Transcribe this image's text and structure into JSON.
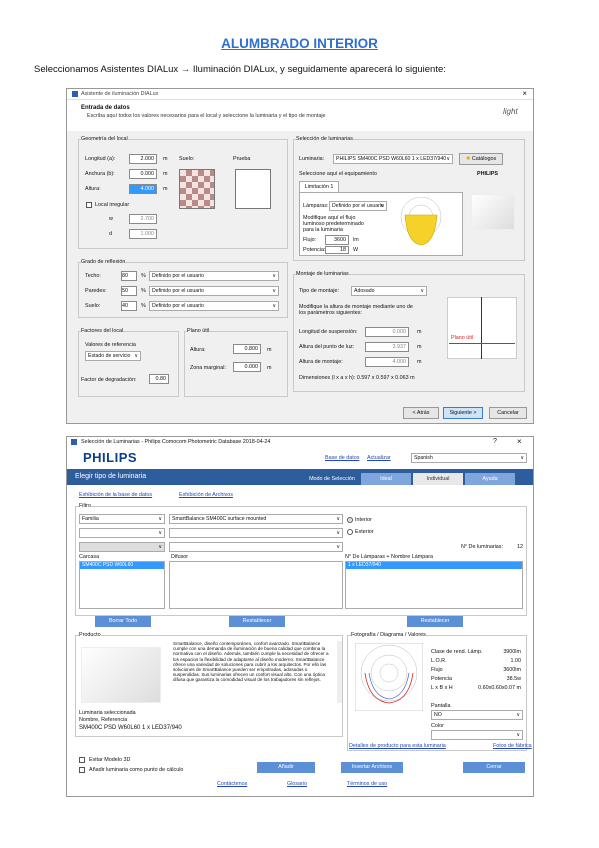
{
  "heading": "ALUMBRADO INTERIOR",
  "intro": "Seleccionamos Asistentes DIALux → Iluminación DIALux, y seguidamente aparecerá lo siguiente:",
  "d1": {
    "title": "Asistente de iluminación DIALux",
    "close": "×",
    "entry_title": "Entrada de datos",
    "entry_sub": "Escriba aquí todos los valores necesarios para el local y seleccione la luminaria y el tipo de montaje",
    "logo": "light",
    "geometry": {
      "legend": "Geometría del local",
      "length_label": "Longitud (a):",
      "length": "2.000",
      "width_label": "Anchura (b):",
      "width": "0.000",
      "height_label": "Altura:",
      "height": "4.000",
      "unit": "m",
      "irregular": "Local irregular",
      "w_label": "w",
      "w_val": "2.700",
      "d_label": "d",
      "d_val": "1.000",
      "suelo": "Suelo:",
      "prueba": "Prueba"
    },
    "reflect": {
      "legend": "Grado de reflexión",
      "rows": [
        {
          "label": "Techo:",
          "val": "80",
          "opt": "Definido por el usuario"
        },
        {
          "label": "Paredes:",
          "val": "50",
          "opt": "Definido por el usuario"
        },
        {
          "label": "Suelo:",
          "val": "40",
          "opt": "Definido por el usuario"
        }
      ],
      "pct": "%"
    },
    "factors": {
      "legend": "Factores del local",
      "ref_label": "Valores de referencia",
      "ref_val": "Estado de servicio",
      "maint_label": "Factor de degradación:",
      "maint_val": "0.80"
    },
    "plane": {
      "legend": "Plano útil",
      "height_label": "Altura:",
      "height": "0.800",
      "zone_label": "Zona marginal:",
      "zone": "0.000",
      "unit": "m"
    },
    "lum": {
      "legend": "Selección de luminarias",
      "label": "Luminaria:",
      "value": "PHILIPS SM400C PSD W60L60 1 x LED37/940",
      "catalog": "Catálogos",
      "pick": "Seleccione aquí el equipamiento",
      "brand": "PHILIPS",
      "tab": "Limitación 1",
      "lamp_label": "Lámparas:",
      "lamp_val": "Definido por el usuario",
      "modify": "Modifique aquí el flujo luminoso predeterminado para la luminaria",
      "flux_label": "Flujo:",
      "flux": "3600",
      "flux_unit": "lm",
      "power_label": "Potencia:",
      "power": "18",
      "power_unit": "W"
    },
    "mount": {
      "legend": "Montaje de luminarias",
      "type_label": "Tipo de montaje:",
      "type_val": "Adosado",
      "note": "Modifique la altura de montaje mediante uno de los parámetros siguientes:",
      "susp_label": "Longitud de suspensión:",
      "susp": "0.000",
      "plane_label": "Altura del punto de luz:",
      "plane": "3.937",
      "mnt_label": "Altura de montaje:",
      "mnt": "4.000",
      "unit": "m",
      "dims": "Dimensiones (l x a x h): 0.597 x 0.597 x 0.063 m",
      "ref_plane": "Plano útil"
    },
    "buttons": {
      "back": "< Atrás",
      "next": "Siguiente >",
      "cancel": "Cancelar"
    }
  },
  "d2": {
    "title": "Selección de Luminarias - Philips Comocom Photometric Database 2018-04-24",
    "help": "?",
    "close": "×",
    "logo": "PHILIPS",
    "top_links": {
      "base": "Base de datos",
      "update": "Actualizar",
      "lang": "Spanish"
    },
    "banner": "Elegir tipo de luminaria",
    "tabs": [
      "Modo de Selección",
      "Ideal",
      "Individual",
      "Ayuda"
    ],
    "sub_links": [
      "Exhibición de la base de datos",
      "Exhibición de Archivos"
    ],
    "filter_legend": "Filtro",
    "filter_sel1": "Familia",
    "filter_sel2": "SmartBalance SM400C surface mounted",
    "radio1": "Interior",
    "radio2": "Exterior",
    "count_label": "N° De luminarias:",
    "count": "12",
    "col1_head": "Carcasa",
    "col1_item": "SM400C PSD W60L60",
    "col2_head": "Difusor",
    "col3_head": "N° De Lámparas + Nombre Lámpara",
    "col3_item": "1 x LED37/940",
    "btn_remove": "Borrar Todo",
    "btn_reset": "Restablecer",
    "btn_reset2": "Restablecer",
    "product_legend": "Producto",
    "product_text": "SmartBalance, diseño contemporáneo, confort avanzado. SmartBalance cumple con una demanda de iluminación de buena calidad que combina la normativa con el diseño. Además, también cumple la necesidad de ofrecer a los espacios la flexibilidad de adaptarse al diseño moderno. SmartBalance ofrece una variedad de soluciones para cubrir a los arquitectos. Por ello las soluciones de SmartBalance pueden ser empotradas, adosadas o suspendidas. Sus luminarias ofrecen un confort visual alto. Con una óptica difusa que garantiza la comodidad visual de los trabajadores sin reflejos.",
    "photo_legend": "Fotografía / Diagrama / Valores",
    "vals": [
      [
        "Clase de rend. Lámp.",
        "3900lm"
      ],
      [
        "L.O.R.",
        "1.00"
      ],
      [
        "Flujo",
        "3600lm"
      ],
      [
        "Potencia",
        "38.5w"
      ],
      [
        "L x B x H",
        "0.60x0.60x0.07 m"
      ]
    ],
    "ik_label": "Pantalla",
    "ik_val": "NO",
    "color_label": "Color",
    "sel_legend": "Luminaria seleccionada",
    "sel_name": "Nombre, Referencia",
    "sel_value": "SM400C PSD W60L60 1 x LED37/940",
    "chk1": "Evitar Modelo 3D",
    "chk2": "Añadir luminaria como punto de cálculo",
    "btn_add": "Añadir",
    "btn_add_file": "Insertar Archivos",
    "btn_close": "Cerrar",
    "link_cfg": "Detalles de producto para esta luminaria",
    "link_more": "Instrucciones",
    "link_sym": "Fotos de fábrica",
    "footer": [
      "Contáctenos",
      "Glosario",
      "Términos de uso"
    ]
  }
}
